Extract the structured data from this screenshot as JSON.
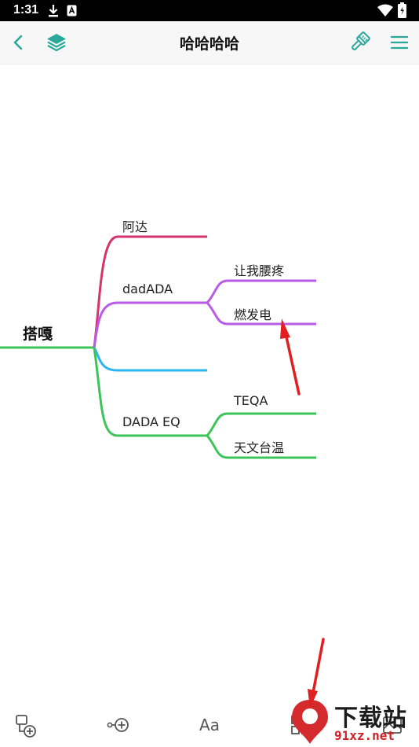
{
  "status_bar": {
    "time": "1:31"
  },
  "top_bar": {
    "title": "哈哈哈哈"
  },
  "mindmap": {
    "root": "搭嘎",
    "branches": [
      {
        "label": "阿达",
        "color": "#d6336c",
        "children": []
      },
      {
        "label": "dadADA",
        "color": "#b85be6",
        "children": [
          "让我腰疼",
          "燃发电"
        ]
      },
      {
        "label": "",
        "color": "#2bb5f0",
        "children": []
      },
      {
        "label": "DADA EQ",
        "color": "#3cc45a",
        "children": [
          "TEQA",
          "天文台温"
        ]
      }
    ]
  },
  "bottom_toolbar": {
    "font_tool_label": "Aa"
  },
  "watermark": {
    "cn": "下载站",
    "site": "91xz.net"
  },
  "colors": {
    "accent": "#2aa99b",
    "annotation_arrow": "#e02020"
  }
}
